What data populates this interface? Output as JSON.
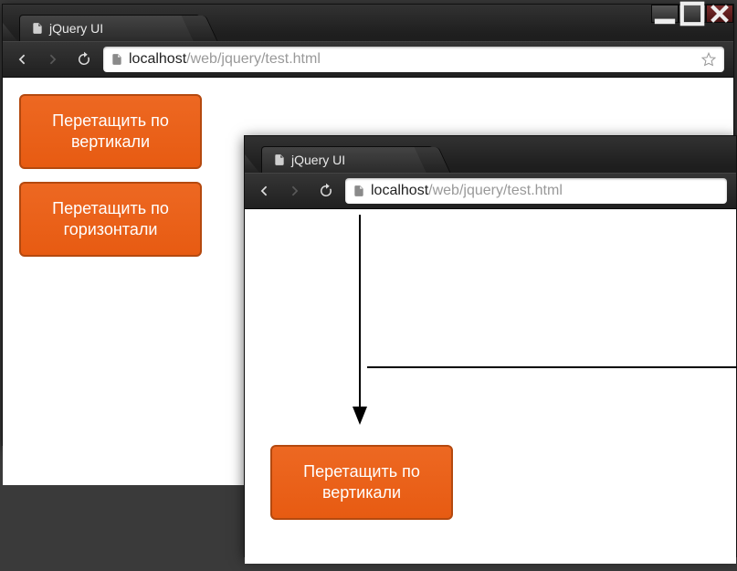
{
  "windowA": {
    "tab_title": "jQuery UI",
    "url_host": "localhost",
    "url_path": "/web/jquery/test.html",
    "visible_title_buttons": true,
    "boxes": {
      "vertical": "Перетащить по вертикали",
      "horizontal": "Перетащить по горизонтали"
    }
  },
  "windowB": {
    "tab_title": "jQuery UI",
    "url_host": "localhost",
    "url_path": "/web/jquery/test.html",
    "box_vertical": "Перетащить по вертикали"
  }
}
